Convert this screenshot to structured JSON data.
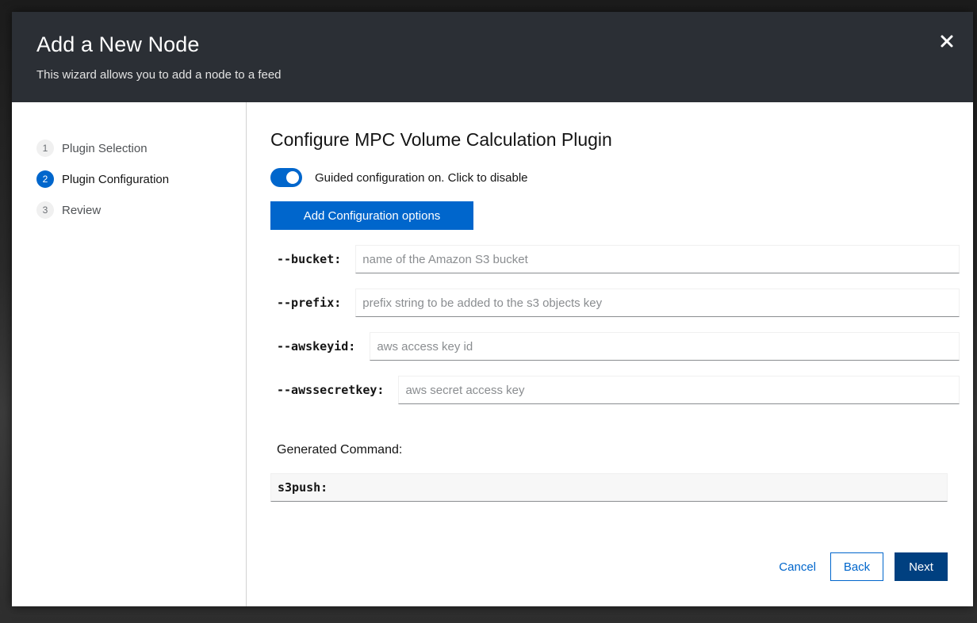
{
  "header": {
    "title": "Add a New Node",
    "subtitle": "This wizard allows you to add a node to a feed",
    "close_icon": "close-icon"
  },
  "nav": {
    "steps": [
      {
        "number": "1",
        "label": "Plugin Selection",
        "current": false
      },
      {
        "number": "2",
        "label": "Plugin Configuration",
        "current": true
      },
      {
        "number": "3",
        "label": "Review",
        "current": false
      }
    ]
  },
  "main": {
    "title": "Configure MPC Volume Calculation Plugin",
    "guided_toggle": {
      "label": "Guided configuration on. Click to disable",
      "on": true
    },
    "add_options_label": "Add Configuration options",
    "fields": [
      {
        "label": "--bucket:",
        "placeholder": "name of the Amazon S3 bucket",
        "value": ""
      },
      {
        "label": "--prefix:",
        "placeholder": "prefix string to be added to the s3 objects key",
        "value": ""
      },
      {
        "label": "--awskeyid:",
        "placeholder": "aws access key id",
        "value": ""
      },
      {
        "label": "--awssecretkey:",
        "placeholder": "aws secret access key",
        "value": ""
      }
    ],
    "generated_label": "Generated Command:",
    "generated_command": "s3push:"
  },
  "footer": {
    "cancel_label": "Cancel",
    "back_label": "Back",
    "next_label": "Next"
  },
  "colors": {
    "header_bg": "#2b2f35",
    "accent": "#0066cc",
    "primary_button": "#004080"
  }
}
